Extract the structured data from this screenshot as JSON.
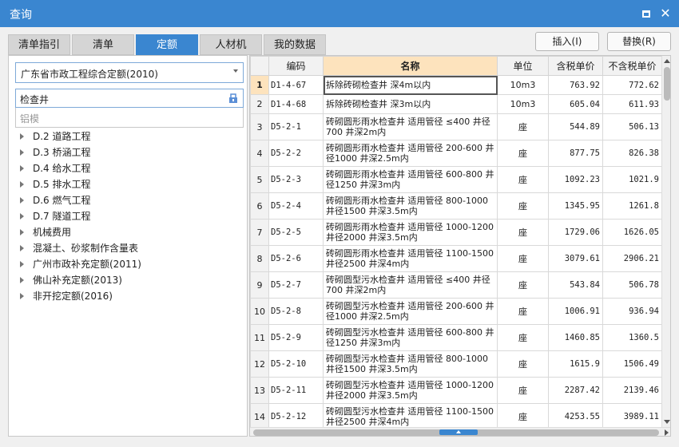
{
  "window": {
    "title": "查询"
  },
  "tabs": [
    {
      "label": "清单指引",
      "active": false
    },
    {
      "label": "清单",
      "active": false
    },
    {
      "label": "定额",
      "active": true
    },
    {
      "label": "人材机",
      "active": false
    },
    {
      "label": "我的数据",
      "active": false
    }
  ],
  "buttons": {
    "insert": "插入(I)",
    "replace": "替换(R)"
  },
  "left": {
    "library": "广东省市政工程综合定额(2010)",
    "search_value": "检查井",
    "suggestion": "铝模",
    "tree": [
      "D.2 道路工程",
      "D.3 桥涵工程",
      "D.4 给水工程",
      "D.5 排水工程",
      "D.6 燃气工程",
      "D.7 隧道工程",
      "机械费用",
      "混凝土、砂浆制作含量表",
      "广州市政补充定额(2011)",
      "佛山补充定额(2013)",
      "非开挖定额(2016)"
    ]
  },
  "table": {
    "headers": {
      "code": "编码",
      "name": "名称",
      "unit": "单位",
      "tax_price": "含税单价",
      "notax_price": "不含税单价"
    },
    "rows": [
      {
        "no": "1",
        "code": "D1-4-67",
        "name": "拆除砖砌检查井 深4m以内",
        "unit": "10m3",
        "tax": "763.92",
        "notax": "772.62"
      },
      {
        "no": "2",
        "code": "D1-4-68",
        "name": "拆除砖砌检查井 深3m以内",
        "unit": "10m3",
        "tax": "605.04",
        "notax": "611.93"
      },
      {
        "no": "3",
        "code": "D5-2-1",
        "name": "砖砌圆形雨水检查井 适用管径 ≤400 井径700 井深2m内",
        "unit": "座",
        "tax": "544.89",
        "notax": "506.13"
      },
      {
        "no": "4",
        "code": "D5-2-2",
        "name": "砖砌圆形雨水检查井 适用管径 200-600 井径1000 井深2.5m内",
        "unit": "座",
        "tax": "877.75",
        "notax": "826.38"
      },
      {
        "no": "5",
        "code": "D5-2-3",
        "name": "砖砌圆形雨水检查井 适用管径 600-800 井径1250 井深3m内",
        "unit": "座",
        "tax": "1092.23",
        "notax": "1021.9"
      },
      {
        "no": "6",
        "code": "D5-2-4",
        "name": "砖砌圆形雨水检查井 适用管径 800-1000 井径1500 井深3.5m内",
        "unit": "座",
        "tax": "1345.95",
        "notax": "1261.8"
      },
      {
        "no": "7",
        "code": "D5-2-5",
        "name": "砖砌圆形雨水检查井 适用管径 1000-1200 井径2000 井深3.5m内",
        "unit": "座",
        "tax": "1729.06",
        "notax": "1626.05"
      },
      {
        "no": "8",
        "code": "D5-2-6",
        "name": "砖砌圆形雨水检查井 适用管径 1100-1500 井径2500 井深4m内",
        "unit": "座",
        "tax": "3079.61",
        "notax": "2906.21"
      },
      {
        "no": "9",
        "code": "D5-2-7",
        "name": "砖砌圆型污水检查井 适用管径 ≤400 井径700 井深2m内",
        "unit": "座",
        "tax": "543.84",
        "notax": "506.78"
      },
      {
        "no": "10",
        "code": "D5-2-8",
        "name": "砖砌圆型污水检查井 适用管径 200-600 井径1000 井深2.5m内",
        "unit": "座",
        "tax": "1006.91",
        "notax": "936.94"
      },
      {
        "no": "11",
        "code": "D5-2-9",
        "name": "砖砌圆型污水检查井 适用管径 600-800 井径1250 井深3m内",
        "unit": "座",
        "tax": "1460.85",
        "notax": "1360.5"
      },
      {
        "no": "12",
        "code": "D5-2-10",
        "name": "砖砌圆型污水检查井 适用管径 800-1000 井径1500 井深3.5m内",
        "unit": "座",
        "tax": "1615.9",
        "notax": "1506.49"
      },
      {
        "no": "13",
        "code": "D5-2-11",
        "name": "砖砌圆型污水检查井 适用管径 1000-1200 井径2000 井深3.5m内",
        "unit": "座",
        "tax": "2287.42",
        "notax": "2139.46"
      },
      {
        "no": "14",
        "code": "D5-2-12",
        "name": "砖砌圆型污水检查井 适用管径 1100-1500 井径2500 井深4m内",
        "unit": "座",
        "tax": "4253.55",
        "notax": "3989.11"
      }
    ]
  },
  "colors": {
    "accent": "#3a86d0",
    "highlight": "#fde3bd"
  }
}
